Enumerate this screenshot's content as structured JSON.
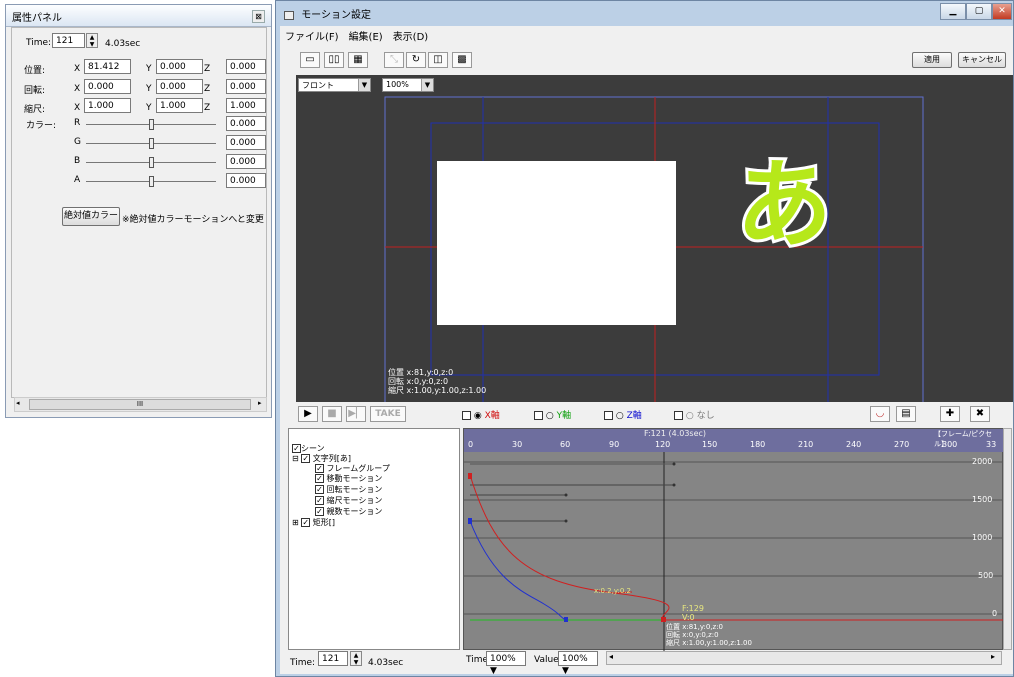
{
  "attr_panel": {
    "title": "属性パネル",
    "time_label": "Time:",
    "time_value": "121",
    "time_sec": "4.03sec",
    "rows": [
      {
        "label": "位置:",
        "x": "81.412",
        "y": "0.000",
        "z": "0.000"
      },
      {
        "label": "回転:",
        "x": "0.000",
        "y": "0.000",
        "z": "0.000"
      },
      {
        "label": "縮尺:",
        "x": "1.000",
        "y": "1.000",
        "z": "1.000"
      }
    ],
    "axis_x": "X",
    "axis_y": "Y",
    "axis_z": "Z",
    "color_label": "カラー:",
    "colors": [
      {
        "ch": "R",
        "value": "0.000"
      },
      {
        "ch": "G",
        "value": "0.000"
      },
      {
        "ch": "B",
        "value": "0.000"
      },
      {
        "ch": "A",
        "value": "0.000"
      }
    ],
    "abs_button": "絶対値カラー",
    "abs_note": "※絶対値カラーモーションへと変更しま",
    "scroll_mark": "III"
  },
  "main": {
    "title": "モーション設定",
    "menu": [
      "ファイル(F)",
      "編集(E)",
      "表示(D)"
    ],
    "apply": "適用",
    "cancel": "キャンセル",
    "view_select": "フロント",
    "zoom_select": "100%",
    "glyph": "あ",
    "viewport_info": [
      "位置 x:81,y:0,z:0",
      "回転 x:0,y:0,z:0",
      "縮尺 x:1.00,y:1.00,z:1.00"
    ],
    "take": "TAKE",
    "axis_toggles": [
      {
        "label": "X軸",
        "color": "#d01010",
        "selected": true
      },
      {
        "label": "Y軸",
        "color": "#10a010",
        "selected": false
      },
      {
        "label": "Z軸",
        "color": "#1010d0",
        "selected": false
      },
      {
        "label": "なし",
        "color": "#777777",
        "selected": false
      }
    ],
    "tree": [
      "シーン",
      "文字列[あ]",
      "フレームグループ",
      "移動モーション",
      "回転モーション",
      "縮尺モーション",
      "親数モーション",
      "矩形[]"
    ],
    "timeline": {
      "cursor": "F:121 (4.03sec)",
      "unit": "【フレーム/ピクセル】",
      "ticks": [
        "0",
        "30",
        "60",
        "90",
        "120",
        "150",
        "180",
        "210",
        "240",
        "270",
        "300",
        "33"
      ],
      "y_ticks": [
        "2000",
        "1500",
        "1000",
        "500",
        "0"
      ],
      "curve_label": "x:0.2,y:0.2",
      "point_label": [
        "F:129",
        "V:0"
      ],
      "info": [
        "位置 x:81,y:0,z:0",
        "回転 x:0,y:0,z:0",
        "縮尺 x:1.00,y:1.00,z:1.00"
      ]
    },
    "bottom": {
      "time_label": "Time:",
      "time_value": "121",
      "time_sec": "4.03sec",
      "time2_label": "Time:",
      "time2_value": "100%",
      "value_label": "Value",
      "value_value": "100%"
    }
  }
}
